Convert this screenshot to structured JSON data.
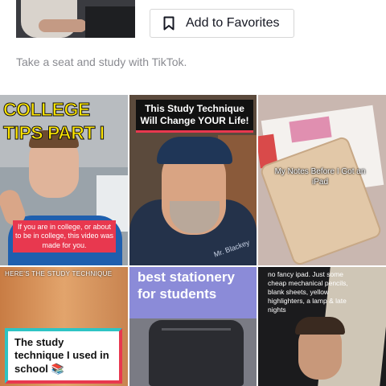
{
  "favorite_button": {
    "label": "Add to Favorites",
    "icon": "bookmark-icon"
  },
  "tagline": "Take a seat and study with TikTok.",
  "videos": [
    {
      "overlay": "COLLEGE TIPS PART I",
      "caption": "If you are in college, or about to be in college, this video was made for you."
    },
    {
      "caption": "This Study Technique Will Change YOUR Life!",
      "shirt_text": "Mr. Blackey"
    },
    {
      "caption": "My Notes Before I Got an iPad"
    },
    {
      "top_text": "HERE'S THE STUDY TECHNIQUE",
      "caption": "The study technique I used in school 📚"
    },
    {
      "caption": "best stationery for students"
    },
    {
      "caption": "no fancy ipad. Just some cheap mechanical pencils, blank sheets, yellow highlighters, a lamp & late nights"
    }
  ],
  "colors": {
    "accent_red": "#fe2c55",
    "caption_bg": "#e8384f",
    "teal_border": "#2ec4c4"
  }
}
